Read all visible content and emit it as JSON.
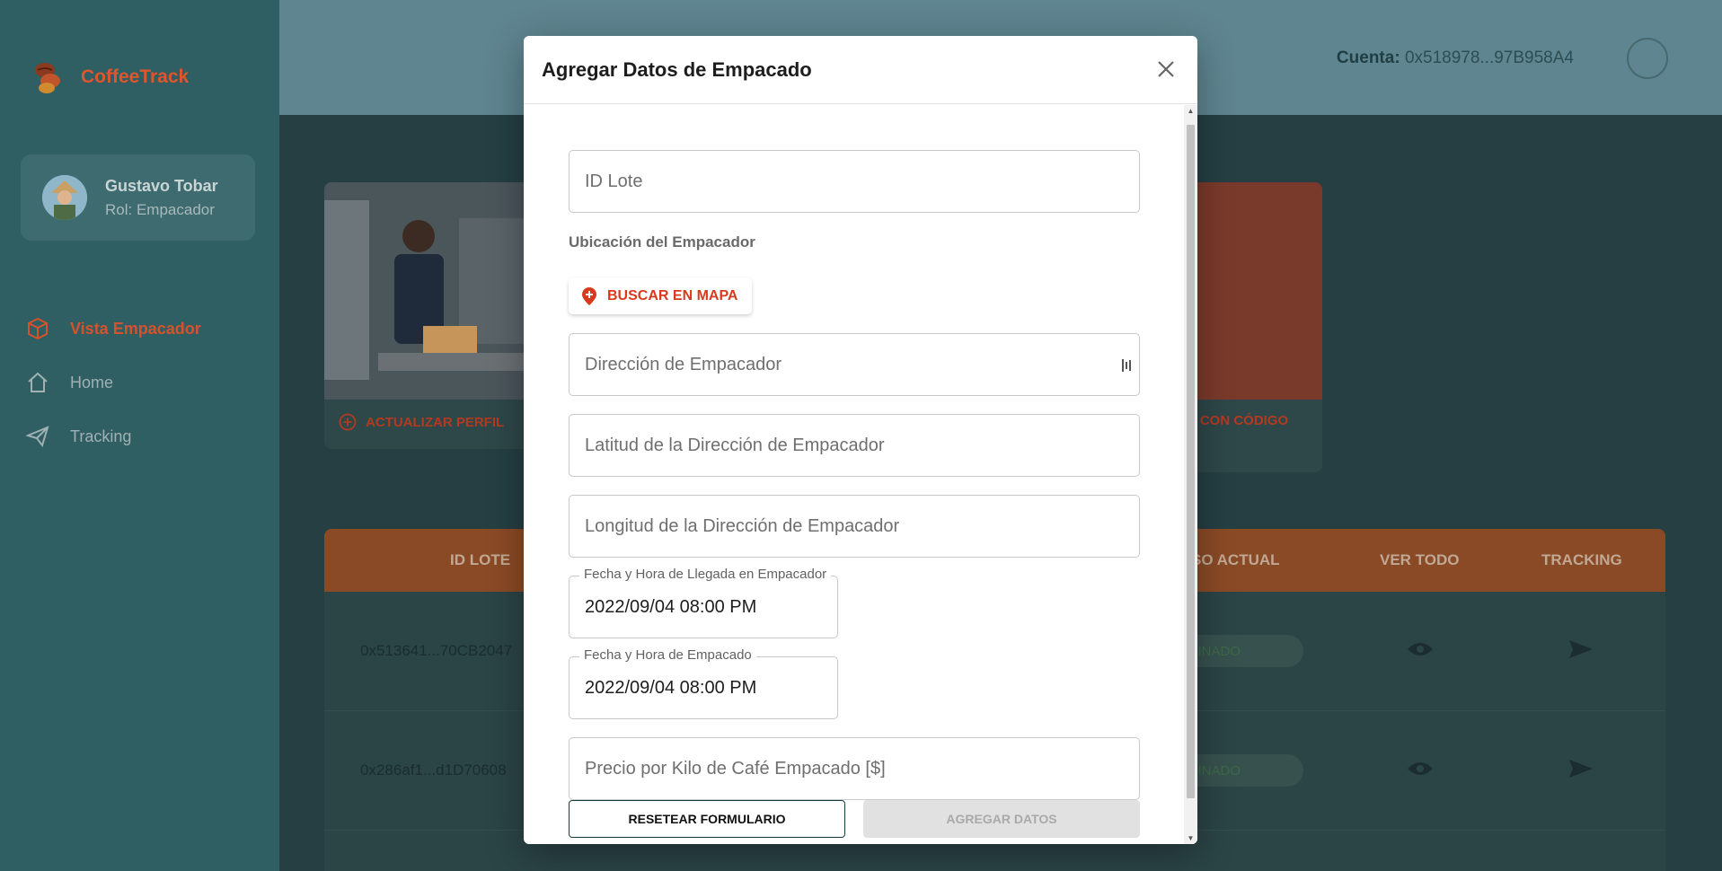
{
  "app": {
    "brand": "CoffeeTrack"
  },
  "profile": {
    "name": "Gustavo Tobar",
    "role": "Rol: Empacador"
  },
  "nav": {
    "items": [
      {
        "label": "Vista Empacador",
        "icon": "box-icon",
        "active": true
      },
      {
        "label": "Home",
        "icon": "home-icon",
        "active": false
      },
      {
        "label": "Tracking",
        "icon": "send-icon",
        "active": false
      }
    ]
  },
  "header": {
    "account_label": "Cuenta:",
    "account_value": "0x518978...97B958A4"
  },
  "cards": {
    "update_profile": "ACTUALIZAR PERFIL",
    "code_action": "O CON CÓDIGO"
  },
  "table": {
    "columns": [
      "ID LOTE",
      "SO ACTUAL",
      "VER TODO",
      "TRACKING"
    ],
    "rows": [
      {
        "id": "0x513641...70CB2047",
        "status": "MINADO"
      },
      {
        "id": "0x286af1...d1D70608",
        "status": "MINADO"
      }
    ]
  },
  "modal": {
    "title": "Agregar Datos de Empacado",
    "fields": {
      "lote_placeholder": "ID Lote",
      "ubicacion_label": "Ubicación del Empacador",
      "map_button": "BUSCAR EN MAPA",
      "direccion_placeholder": "Dirección de Empacador",
      "latitud_placeholder": "Latitud de la Dirección de Empacador",
      "longitud_placeholder": "Longitud de la Dirección de Empacador",
      "fecha_llegada_label": "Fecha y Hora de Llegada en Empacador",
      "fecha_llegada_value": "2022/09/04 08:00 PM",
      "fecha_empacado_label": "Fecha y Hora de Empacado",
      "fecha_empacado_value": "2022/09/04 08:00 PM",
      "precio_placeholder": "Precio por Kilo de Café Empacado [$]"
    },
    "buttons": {
      "reset": "RESETEAR FORMULARIO",
      "add": "AGREGAR DATOS"
    }
  },
  "colors": {
    "accent": "#d83a1d",
    "sidebar": "#2f5e63",
    "table_header": "#8a4a26"
  }
}
